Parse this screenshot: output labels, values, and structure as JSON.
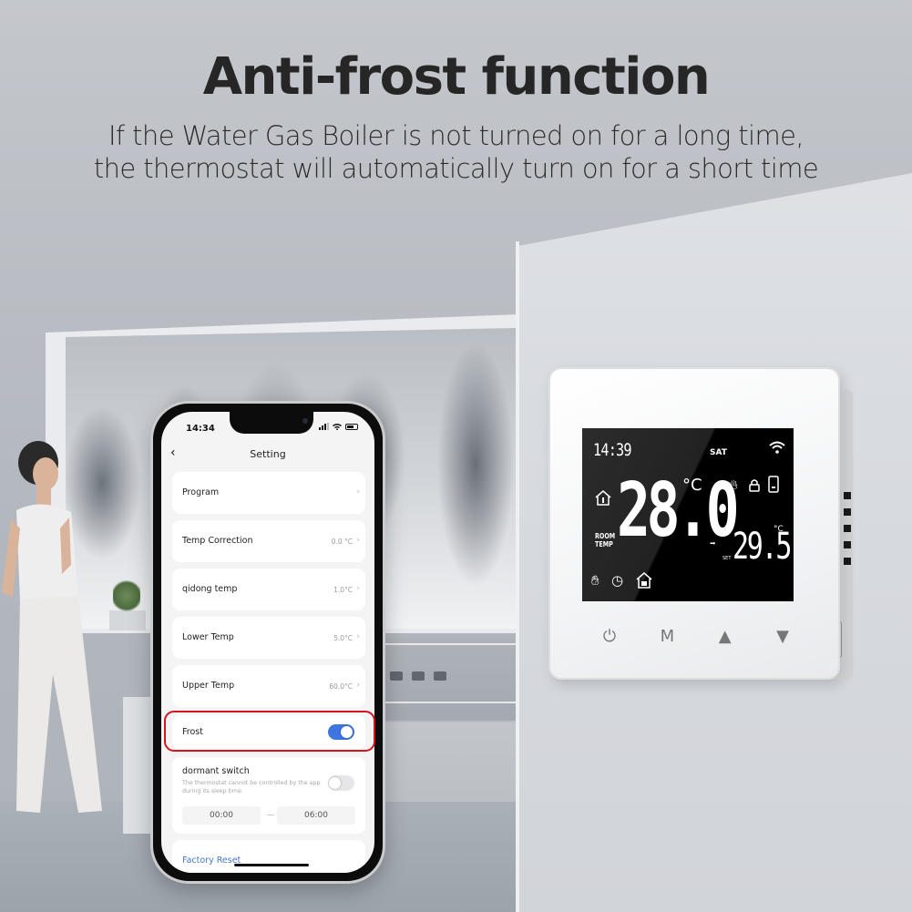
{
  "headline": {
    "title": "Anti-frost function",
    "subtitle_line1": "If the Water Gas Boiler is not turned on for a long time,",
    "subtitle_line2": "the thermostat will automatically turn on for a short time"
  },
  "phone": {
    "status_bar": {
      "time": "14:34",
      "icons": [
        "signal-icon",
        "wifi-icon",
        "battery-icon"
      ]
    },
    "nav": {
      "back_icon": "‹",
      "title": "Setting"
    },
    "settings": [
      {
        "label": "Program",
        "value": "",
        "chevron": "›"
      },
      {
        "label": "Temp Correction",
        "value": "0.0 °C",
        "chevron": "›"
      },
      {
        "label": "qidong temp",
        "value": "1.0°C",
        "chevron": "›"
      },
      {
        "label": "Lower Temp",
        "value": "5.0°C",
        "chevron": "›"
      },
      {
        "label": "Upper Temp",
        "value": "60.0°C",
        "chevron": "›"
      }
    ],
    "frost": {
      "label": "Frost",
      "enabled": true,
      "highlight_color": "#d5141d"
    },
    "dormant": {
      "label": "dormant switch",
      "description": "The thermostat cannot be controlled by the app during its sleep time.",
      "enabled": false,
      "start_time": "00:00",
      "end_time": "06:00"
    },
    "factory_reset": "Factory Reset",
    "accent_color": "#3d76e0"
  },
  "thermostat": {
    "clock": "14:39",
    "day": "SAT",
    "room_temp": "28.0",
    "room_temp_unit": "°C",
    "room_label_line1": "ROOM",
    "room_label_line2": "TEMP",
    "set_label": "SET",
    "set_temp": "29.5",
    "set_temp_unit": "°C",
    "arrow": "➡",
    "icons": [
      "wifi-icon",
      "flame-icon",
      "lock-icon",
      "battery-icon",
      "home-icon",
      "hand-icon",
      "clock-icon",
      "away-home-icon",
      "sun-icon"
    ],
    "buttons": [
      {
        "name": "power",
        "glyph": "⏻"
      },
      {
        "name": "mode",
        "glyph": "M"
      },
      {
        "name": "up",
        "glyph": "▲"
      },
      {
        "name": "down",
        "glyph": "▼"
      }
    ]
  }
}
